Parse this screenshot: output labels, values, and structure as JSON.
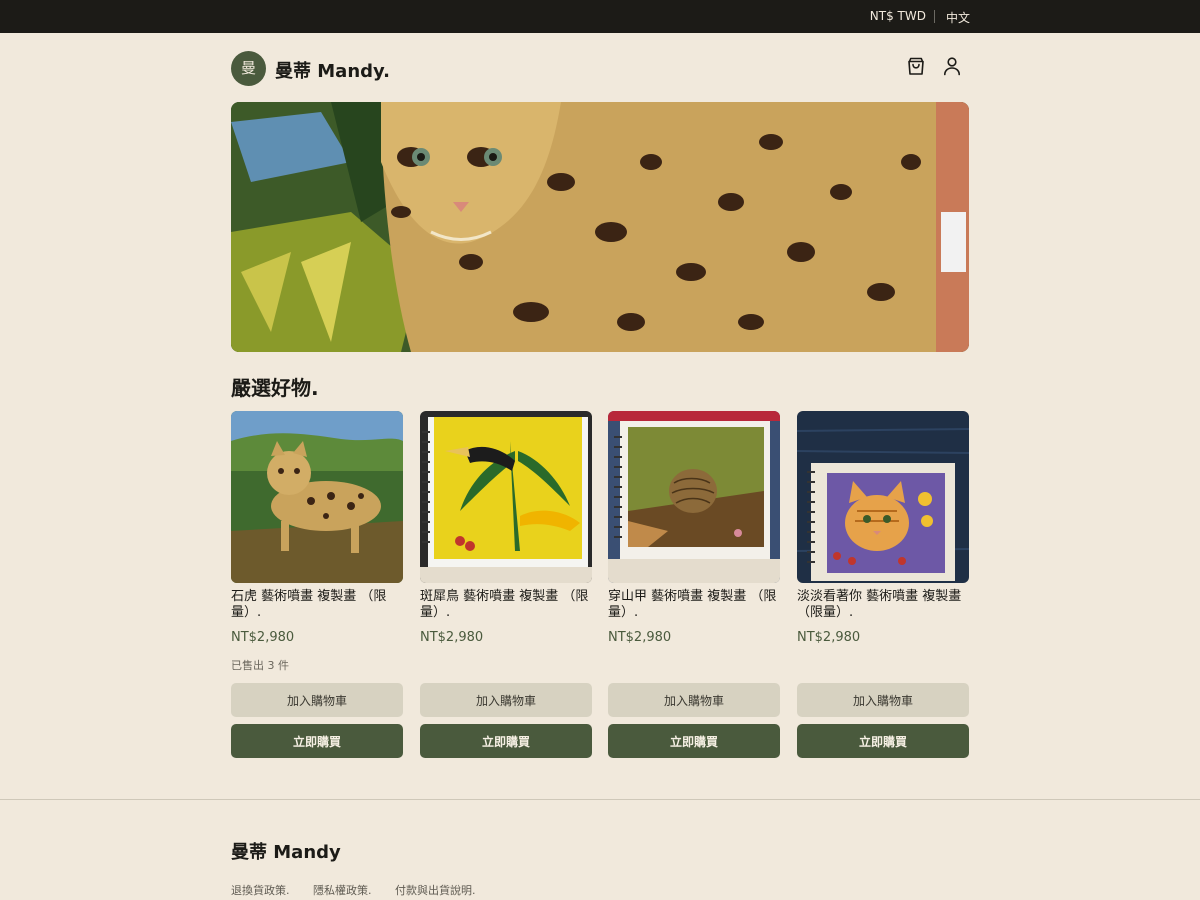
{
  "topbar": {
    "currency": "NT$ TWD",
    "language": "中文"
  },
  "header": {
    "logo_text": "曼",
    "brand": "曼蒂 Mandy.",
    "cart_icon": "shopping-bag-icon",
    "account_icon": "user-icon"
  },
  "hero": {
    "image": "ocelot-painting"
  },
  "section": {
    "title": "嚴選好物."
  },
  "products": [
    {
      "name": "石虎 藝術噴畫 複製畫 （限量）.",
      "price": "NT$2,980",
      "sold": "已售出 3 件",
      "image": "leopard-cat-painting"
    },
    {
      "name": "斑犀鳥 藝術噴畫 複製畫 （限量）.",
      "price": "NT$2,980",
      "sold": "",
      "image": "hornbill-painting"
    },
    {
      "name": "穿山甲 藝術噴畫 複製畫 （限量）.",
      "price": "NT$2,980",
      "sold": "",
      "image": "pangolin-painting"
    },
    {
      "name": "淡淡看著你 藝術噴畫 複製畫 （限量）.",
      "price": "NT$2,980",
      "sold": "",
      "image": "cat-painting"
    }
  ],
  "buttons": {
    "add_to_cart": "加入購物車",
    "buy_now": "立即購買"
  },
  "footer": {
    "brand": "曼蒂 Mandy",
    "links": [
      "退換貨政策.",
      "隱私權政策.",
      "付款與出貨說明."
    ]
  },
  "colors": {
    "accent": "#4a5a3d",
    "background": "#f1e9dc",
    "topbar": "#1c1b17",
    "secondary_button": "#d7d2c1"
  }
}
